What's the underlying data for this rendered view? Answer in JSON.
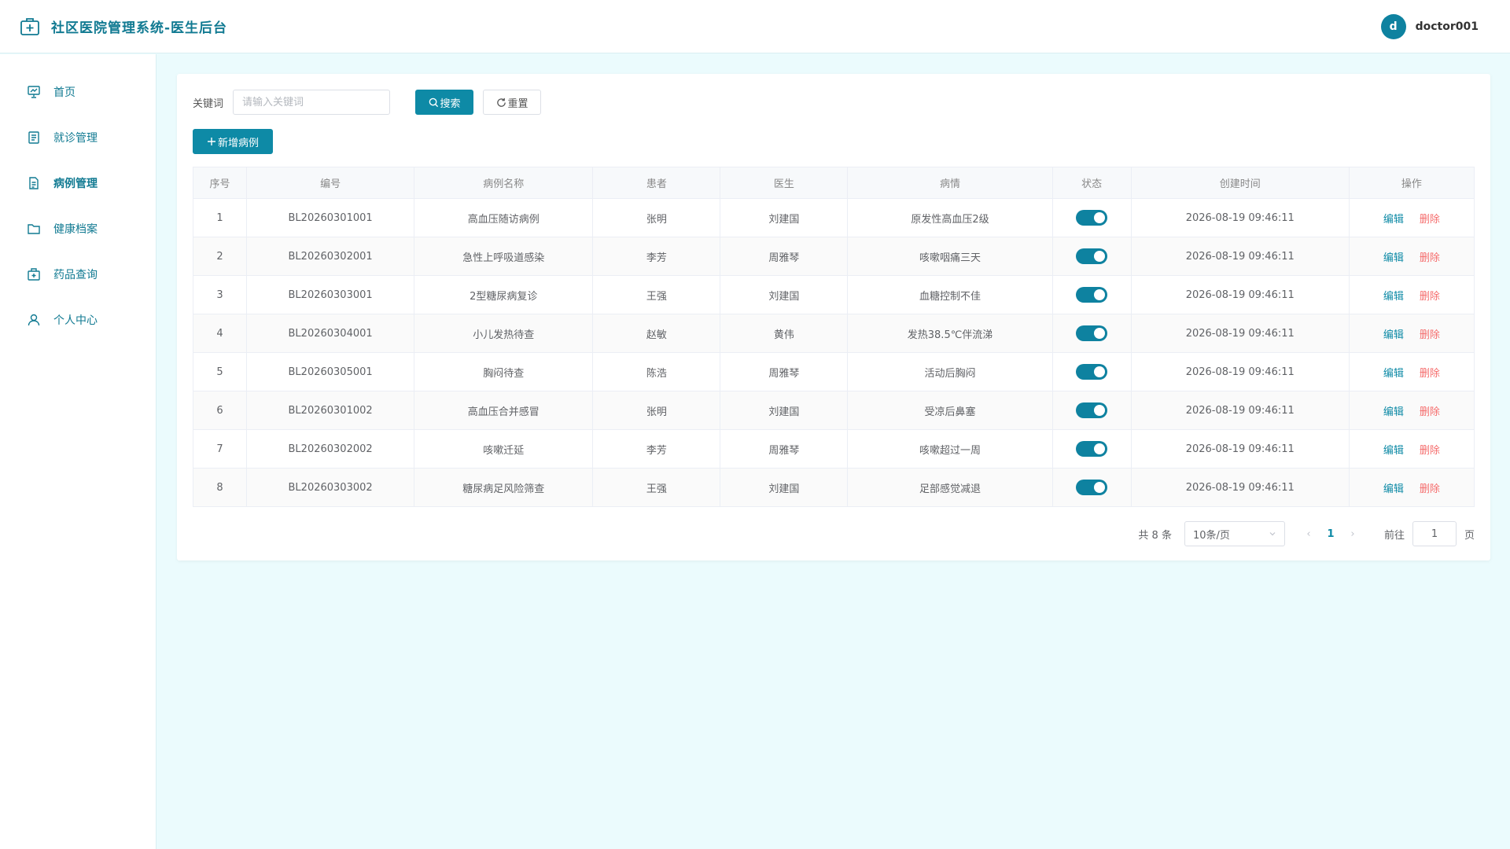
{
  "header": {
    "title": "社区医院管理系统-医生后台",
    "user_initial": "d",
    "username": "doctor001"
  },
  "sidebar": {
    "items": [
      {
        "label": "首页",
        "icon": "dashboard-icon"
      },
      {
        "label": "就诊管理",
        "icon": "document-icon"
      },
      {
        "label": "病例管理",
        "icon": "file-icon",
        "active": true
      },
      {
        "label": "健康档案",
        "icon": "folder-icon"
      },
      {
        "label": "药品查询",
        "icon": "medicine-box-icon"
      },
      {
        "label": "个人中心",
        "icon": "user-icon"
      }
    ]
  },
  "filters": {
    "keyword_label": "关键词",
    "keyword_placeholder": "请输入关键词",
    "search_label": "搜索",
    "reset_label": "重置",
    "add_label": "新增病例"
  },
  "table": {
    "columns": [
      "序号",
      "编号",
      "病例名称",
      "患者",
      "医生",
      "病情",
      "状态",
      "创建时间",
      "操作"
    ],
    "edit_label": "编辑",
    "delete_label": "删除",
    "rows": [
      {
        "index": "1",
        "code": "BL20260301001",
        "name": "高血压随访病例",
        "patient": "张明",
        "doctor": "刘建国",
        "condition": "原发性高血压2级",
        "enabled": true,
        "created": "2026-08-19 09:46:11"
      },
      {
        "index": "2",
        "code": "BL20260302001",
        "name": "急性上呼吸道感染",
        "patient": "李芳",
        "doctor": "周雅琴",
        "condition": "咳嗽咽痛三天",
        "enabled": true,
        "created": "2026-08-19 09:46:11"
      },
      {
        "index": "3",
        "code": "BL20260303001",
        "name": "2型糖尿病复诊",
        "patient": "王强",
        "doctor": "刘建国",
        "condition": "血糖控制不佳",
        "enabled": true,
        "created": "2026-08-19 09:46:11"
      },
      {
        "index": "4",
        "code": "BL20260304001",
        "name": "小儿发热待查",
        "patient": "赵敏",
        "doctor": "黄伟",
        "condition": "发热38.5℃伴流涕",
        "enabled": true,
        "created": "2026-08-19 09:46:11"
      },
      {
        "index": "5",
        "code": "BL20260305001",
        "name": "胸闷待查",
        "patient": "陈浩",
        "doctor": "周雅琴",
        "condition": "活动后胸闷",
        "enabled": true,
        "created": "2026-08-19 09:46:11"
      },
      {
        "index": "6",
        "code": "BL20260301002",
        "name": "高血压合并感冒",
        "patient": "张明",
        "doctor": "刘建国",
        "condition": "受凉后鼻塞",
        "enabled": true,
        "created": "2026-08-19 09:46:11"
      },
      {
        "index": "7",
        "code": "BL20260302002",
        "name": "咳嗽迁延",
        "patient": "李芳",
        "doctor": "周雅琴",
        "condition": "咳嗽超过一周",
        "enabled": true,
        "created": "2026-08-19 09:46:11"
      },
      {
        "index": "8",
        "code": "BL20260303002",
        "name": "糖尿病足风险筛查",
        "patient": "王强",
        "doctor": "刘建国",
        "condition": "足部感觉减退",
        "enabled": true,
        "created": "2026-08-19 09:46:11"
      }
    ]
  },
  "pagination": {
    "total_text": "共 8 条",
    "page_size": "10条/页",
    "current_page": "1",
    "goto_label": "前往",
    "goto_value": "1",
    "page_suffix": "页"
  },
  "colors": {
    "accent": "#0e8aa6",
    "danger": "#f56c6c",
    "background": "#ebfbfd"
  }
}
